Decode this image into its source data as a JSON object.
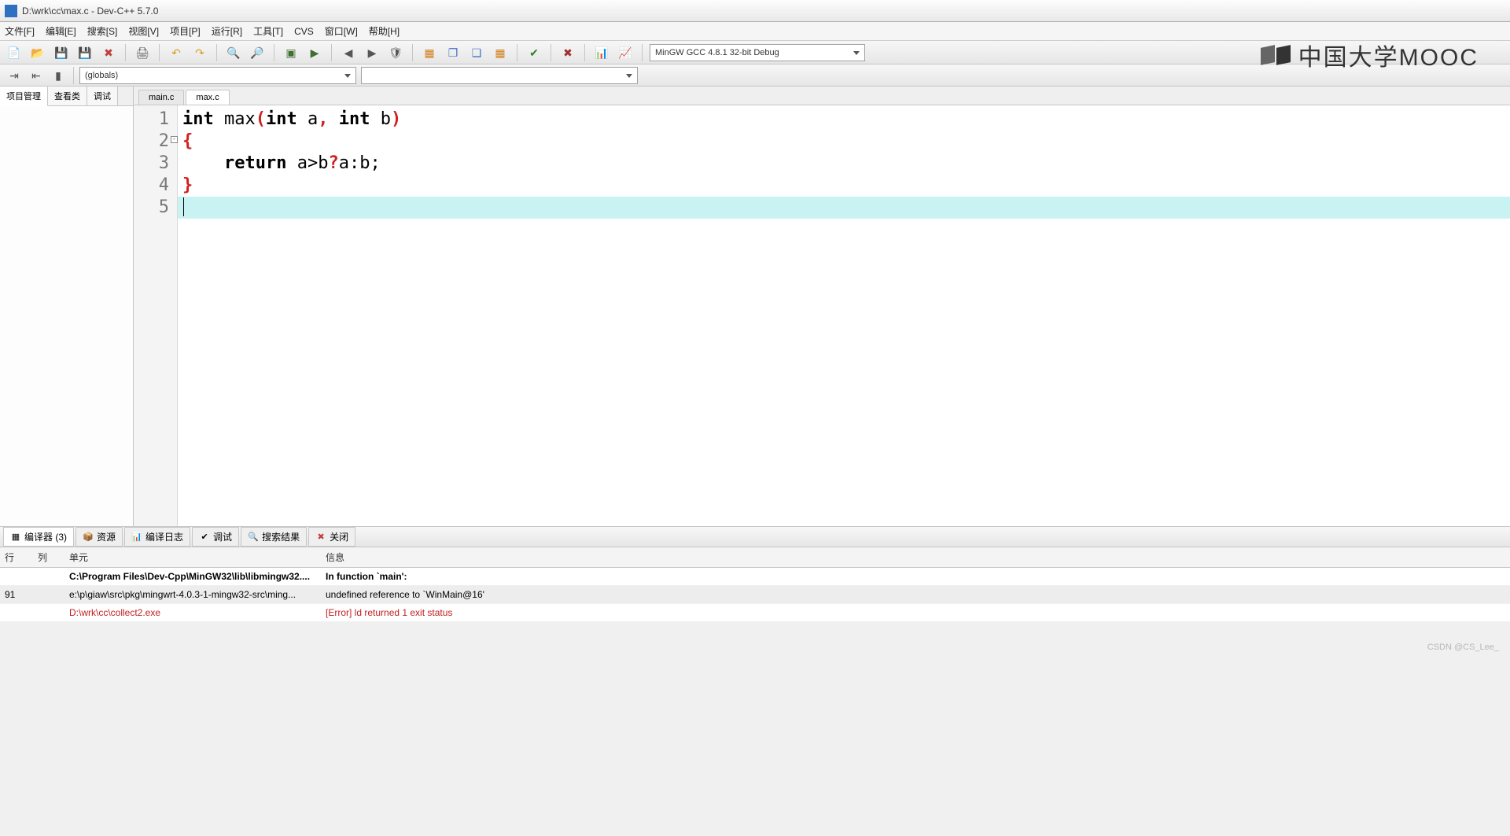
{
  "title": "D:\\wrk\\cc\\max.c - Dev-C++ 5.7.0",
  "menu": {
    "file": "文件[F]",
    "edit": "编辑[E]",
    "search": "搜索[S]",
    "view": "视图[V]",
    "project": "项目[P]",
    "run": "运行[R]",
    "tools": "工具[T]",
    "cvs": "CVS",
    "window": "窗口[W]",
    "help": "帮助[H]"
  },
  "compiler_combo": "MinGW GCC 4.8.1 32-bit Debug",
  "scope_combo": "(globals)",
  "sidebar_tabs": {
    "project": "项目管理",
    "classes": "查看类",
    "debug": "调试"
  },
  "file_tabs": {
    "main": "main.c",
    "max": "max.c"
  },
  "code": {
    "l1_int": "int",
    "l1_fn": " max",
    "l1_int2": "int",
    "l1_a": " a",
    "l1_int3": "int",
    "l1_b": " b",
    "l2": "{",
    "l3_ret": "return",
    "l3_expr": " a>b",
    "l3_q": "?",
    "l3_rest": "a:b;",
    "l4": "}",
    "ln1": "1",
    "ln2": "2",
    "ln3": "3",
    "ln4": "4",
    "ln5": "5"
  },
  "bottom_tabs": {
    "compiler": "编译器 (3)",
    "resource": "资源",
    "log": "编译日志",
    "debug": "调试",
    "search": "搜索结果",
    "close": "关闭"
  },
  "err_head": {
    "line": "行",
    "col": "列",
    "unit": "单元",
    "msg": "信息"
  },
  "errors": [
    {
      "line": "",
      "col": "",
      "unit": "C:\\Program Files\\Dev-Cpp\\MinGW32\\lib\\libmingw32....",
      "msg": "In function `main':",
      "bold": true
    },
    {
      "line": "91",
      "col": "",
      "unit": "e:\\p\\giaw\\src\\pkg\\mingwrt-4.0.3-1-mingw32-src\\ming...",
      "msg": "undefined reference to `WinMain@16'",
      "sel": true
    },
    {
      "line": "",
      "col": "",
      "unit": "D:\\wrk\\cc\\collect2.exe",
      "msg": "[Error] ld returned 1 exit status",
      "red": true
    }
  ],
  "watermark": "中国大学MOOC",
  "credit": "CSDN @CS_Lee_"
}
